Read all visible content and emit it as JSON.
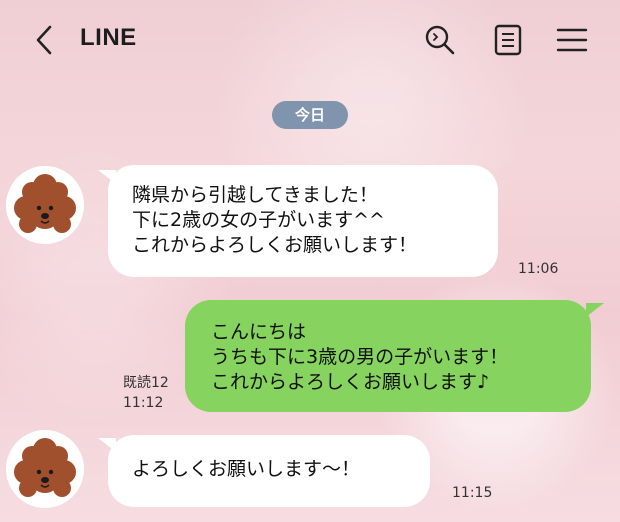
{
  "header": {
    "title": "LINE",
    "icons": [
      "back-arrow-icon",
      "search-icon",
      "notes-icon",
      "menu-icon"
    ]
  },
  "date_separator": "今日",
  "messages": [
    {
      "side": "received",
      "text": "隣県から引越してきました！\n下に2歳の女の子がいます^^\nこれからよろしくお願いします！",
      "time": "11:06"
    },
    {
      "side": "sent",
      "text": "こんにちは\nうちも下に3歳の男の子がいます！\nこれからよろしくお願いします♪",
      "read": "既読12",
      "time": "11:12"
    },
    {
      "side": "received",
      "text": "よろしくお願いします〜！",
      "time": "11:15"
    }
  ],
  "colors": {
    "sent_bubble": "#86d35f",
    "received_bubble": "#ffffff",
    "date_pill": "#8094ad",
    "avatar_dog": "#a0502c"
  }
}
